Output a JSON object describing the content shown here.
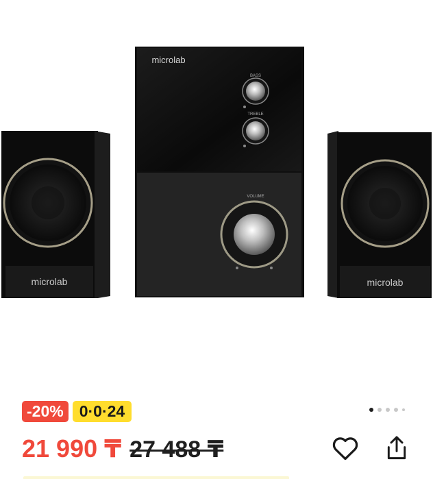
{
  "product": {
    "image_alt": "Microlab 2.1 speaker system",
    "brand_text": "microlab",
    "knob_labels": {
      "bass": "BASS",
      "treble": "TREBLE",
      "volume": "VOLUME"
    }
  },
  "badges": {
    "discount": "-20%",
    "timer": "0·0·24"
  },
  "pagination": {
    "dots": 5,
    "active_index": 0
  },
  "price": {
    "current": "21 990 ₸",
    "old": "27 488 ₸"
  },
  "actions": {
    "favorite_icon": "heart-icon",
    "share_icon": "share-icon"
  },
  "colors": {
    "accent_red": "#f0493b",
    "timer_yellow": "#ffdd2d",
    "text_dark": "#1f1f1f"
  }
}
